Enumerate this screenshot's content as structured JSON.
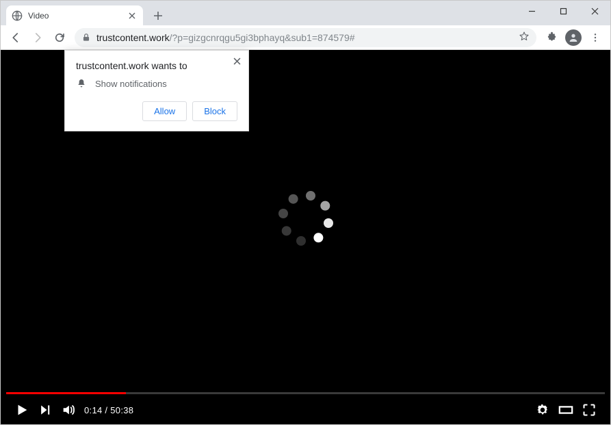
{
  "tab": {
    "title": "Video"
  },
  "url": {
    "domain": "trustcontent.work",
    "path": "/?p=gizgcnrqgu5gi3bphayq&sub1=874579#"
  },
  "permission": {
    "title": "trustcontent.work wants to",
    "request": "Show notifications",
    "allow": "Allow",
    "block": "Block"
  },
  "player": {
    "current_time": "0:14",
    "duration": "50:38",
    "separator": " / "
  }
}
